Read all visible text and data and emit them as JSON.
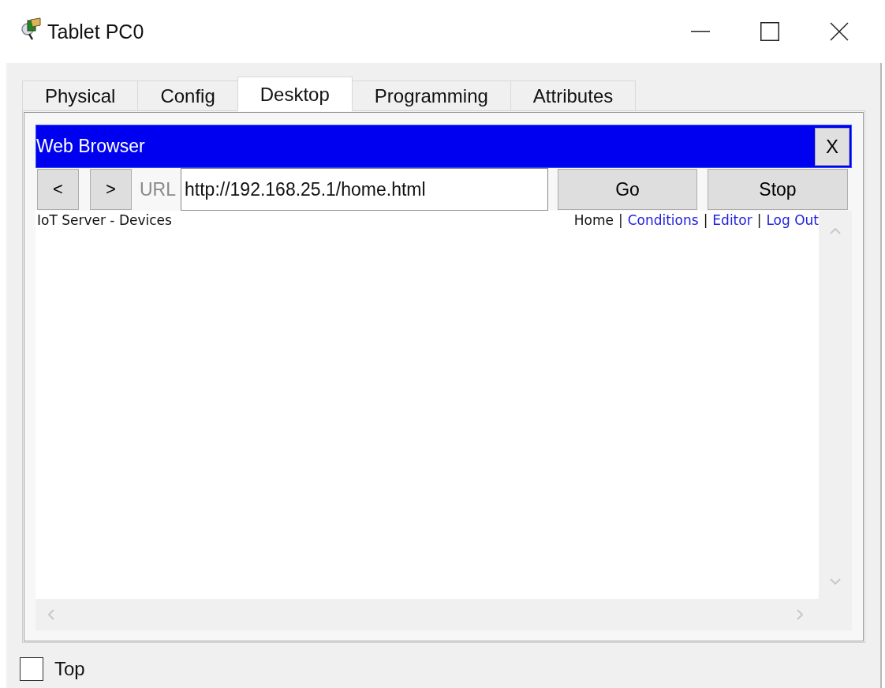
{
  "window": {
    "title": "Tablet PC0"
  },
  "tabs": [
    {
      "label": "Physical",
      "selected": false
    },
    {
      "label": "Config",
      "selected": false
    },
    {
      "label": "Desktop",
      "selected": true
    },
    {
      "label": "Programming",
      "selected": false
    },
    {
      "label": "Attributes",
      "selected": false
    }
  ],
  "browser": {
    "title": "Web Browser",
    "close": "X",
    "back": "<",
    "forward": ">",
    "url_label": "URL",
    "url": "http://192.168.25.1/home.html",
    "go": "Go",
    "stop": "Stop",
    "page_title": "IoT Server - Devices",
    "nav": [
      {
        "label": "Home",
        "selected": true
      },
      {
        "label": "Conditions",
        "selected": false
      },
      {
        "label": "Editor",
        "selected": false
      },
      {
        "label": "Log Out",
        "selected": false
      }
    ],
    "separator": "|"
  },
  "top_checkbox": {
    "label": "Top",
    "checked": false
  }
}
